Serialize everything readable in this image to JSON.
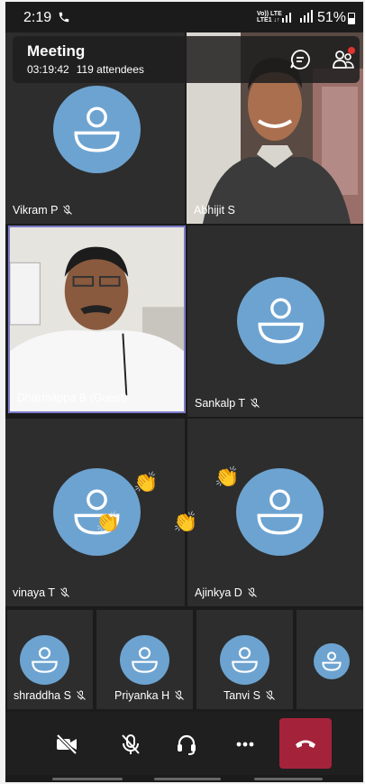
{
  "status_bar": {
    "time": "2:19",
    "network": [
      "Vo)) LTE",
      "LTE1 ↓↑"
    ],
    "battery": "51%"
  },
  "meeting": {
    "title": "Meeting",
    "duration": "03:19:42",
    "attendees": "119 attendees"
  },
  "participants": [
    {
      "name": "Vikram P",
      "muted": true,
      "video": false
    },
    {
      "name": "Abhijit S",
      "muted": false,
      "video": true
    },
    {
      "name": "Dharmappa B (Guest)",
      "muted": false,
      "video": true,
      "active_speaker": true
    },
    {
      "name": "Sankalp T",
      "muted": true,
      "video": false
    },
    {
      "name": "vinaya T",
      "muted": true,
      "video": false
    },
    {
      "name": "Ajinkya D",
      "muted": true,
      "video": false
    },
    {
      "name": "shraddha S",
      "muted": true,
      "video": false
    },
    {
      "name": "Priyanka H",
      "muted": true,
      "video": false
    },
    {
      "name": "Tanvi S",
      "muted": true,
      "video": false
    }
  ],
  "reactions": {
    "clap": "👏"
  },
  "icons": {
    "call": "phone-icon",
    "chat": "chat-icon",
    "people": "people-icon",
    "camera_off": "camera-off-icon",
    "mic_off": "mic-off-icon",
    "audio": "headset-icon",
    "more": "more-icon",
    "hangup": "hang-up-icon"
  },
  "colors": {
    "avatar": "#6da3d0",
    "hangup": "#a4233a",
    "active_border": "#7b7ac8",
    "notification_dot": "#e0332f"
  }
}
